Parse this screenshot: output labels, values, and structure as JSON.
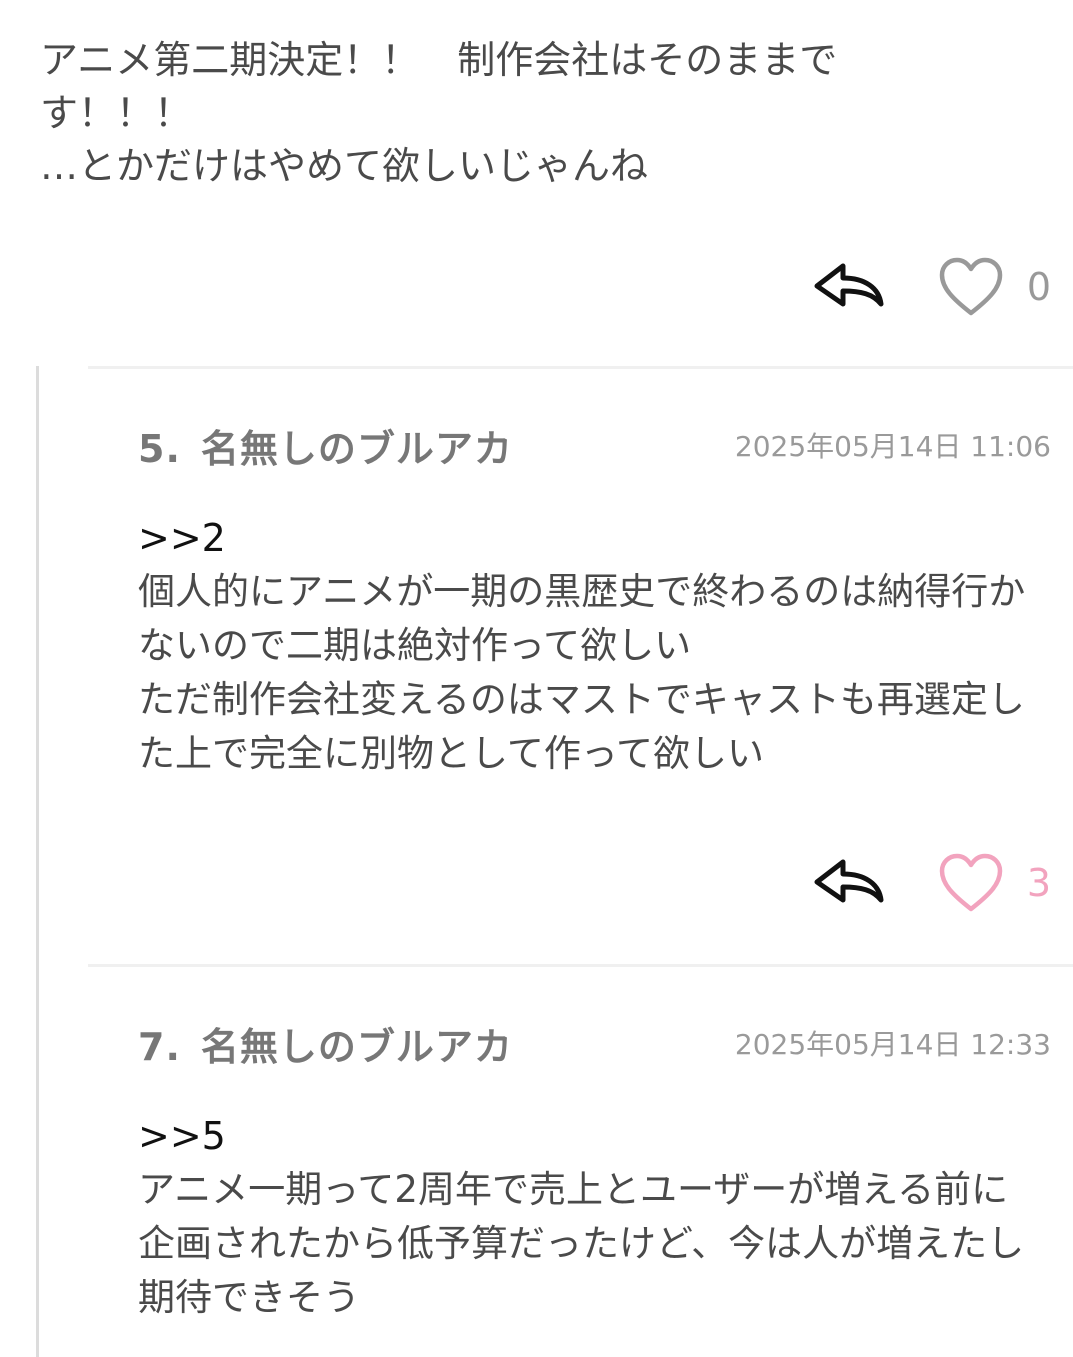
{
  "top_post": {
    "body": "アニメ第二期決定！！　制作会社はそのままです！！！\n…とかだけはやめて欲しいじゃんね",
    "like_count": "0",
    "liked": false
  },
  "replies": [
    {
      "number": "5.",
      "name": "名無しのブルアカ",
      "date": "2025年05月14日 11:06",
      "anchor": ">>2",
      "body": "個人的にアニメが一期の黒歴史で終わるのは納得行かないので二期は絶対作って欲しい\nただ制作会社変えるのはマストでキャストも再選定した上で完全に別物として作って欲しい",
      "like_count": "3",
      "liked": true
    },
    {
      "number": "7.",
      "name": "名無しのブルアカ",
      "date": "2025年05月14日 12:33",
      "anchor": ">>5",
      "body": "アニメ一期って2周年で売上とユーザーが増える前に企画されたから低予算だったけど、今は人が増えたし期待できそう"
    }
  ],
  "icons": {
    "reply": "reply-arrow-icon",
    "like": "heart-icon"
  },
  "colors": {
    "heart_inactive": "#999999",
    "heart_active": "#f2a3be",
    "like_count_inactive": "#999999",
    "like_count_active": "#f2a3be",
    "thread_line": "#dcdcdc"
  }
}
